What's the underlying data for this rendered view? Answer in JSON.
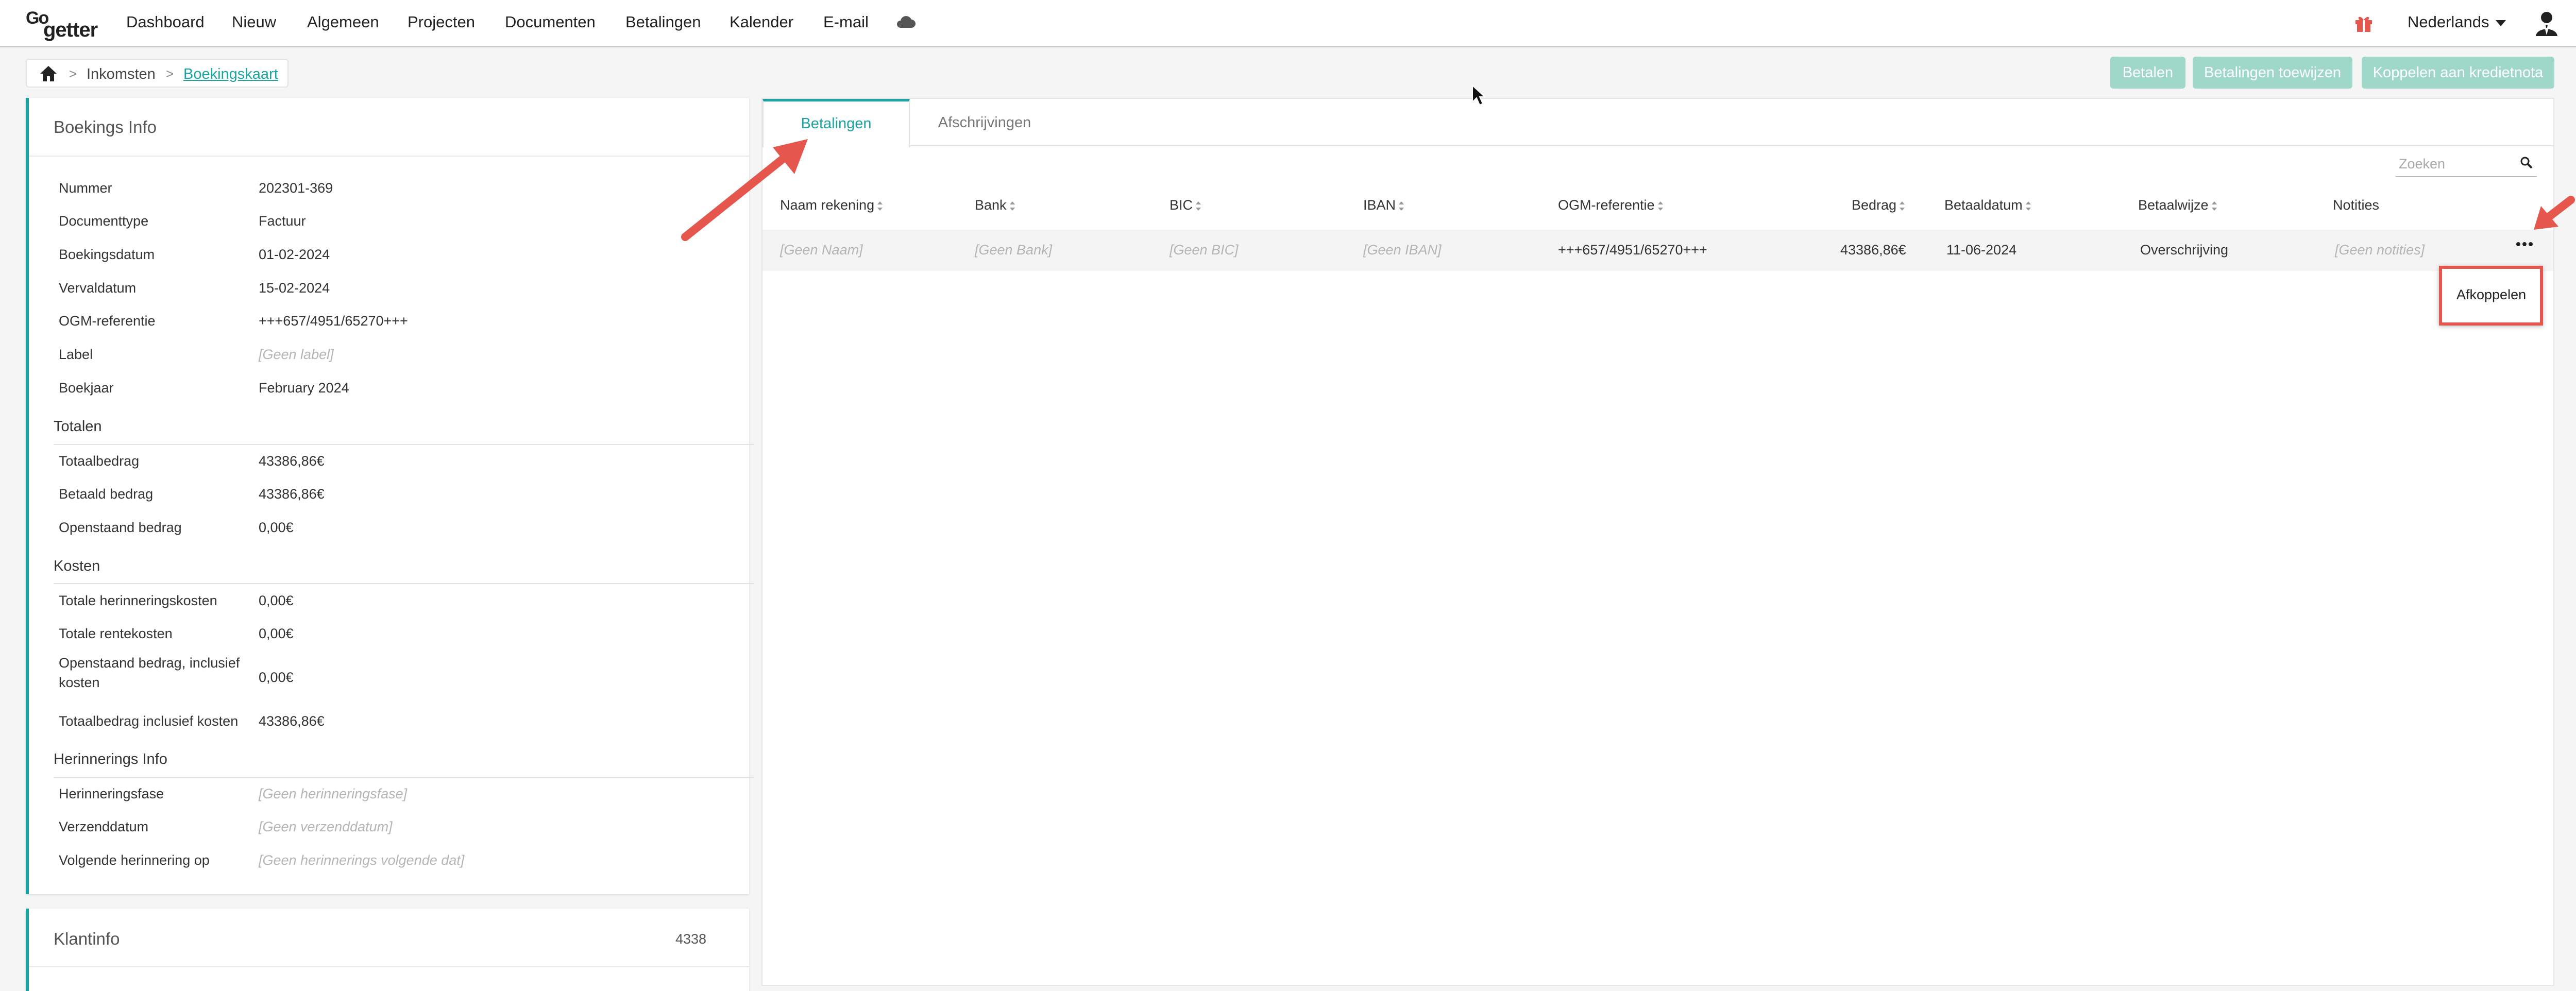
{
  "nav": {
    "logo_go": "Go",
    "logo_getter": "getter",
    "items": [
      "Dashboard",
      "Nieuw",
      "Algemeen",
      "Projecten",
      "Documenten",
      "Betalingen",
      "Kalender",
      "E-mail"
    ],
    "language": "Nederlands",
    "icons": [
      "cloud-icon",
      "gift-icon",
      "user-icon"
    ],
    "gift_color": "#e5574d"
  },
  "breadcrumb": {
    "items": [
      "Inkomsten",
      "Boekingskaart"
    ]
  },
  "actions": {
    "pay": "Betalen",
    "assign": "Betalingen toewijzen",
    "link_credit": "Koppelen aan kredietnota"
  },
  "booking": {
    "title": "Boekings Info",
    "fields": [
      {
        "label": "Nummer",
        "value": "202301-369"
      },
      {
        "label": "Documenttype",
        "value": "Factuur"
      },
      {
        "label": "Boekingsdatum",
        "value": "01-02-2024"
      },
      {
        "label": "Vervaldatum",
        "value": "15-02-2024"
      },
      {
        "label": "OGM-referentie",
        "value": "+++657/4951/65270+++"
      },
      {
        "label": "Label",
        "value": "[Geen label]"
      },
      {
        "label": "Boekjaar",
        "value": "February 2024"
      }
    ],
    "totals_title": "Totalen",
    "totals": [
      {
        "label": "Totaalbedrag",
        "value": "43386,86€"
      },
      {
        "label": "Betaald bedrag",
        "value": "43386,86€"
      },
      {
        "label": "Openstaand bedrag",
        "value": "0,00€"
      }
    ],
    "costs_title": "Kosten",
    "costs": [
      {
        "label": "Totale herinneringskosten",
        "value": "0,00€"
      },
      {
        "label": "Totale rentekosten",
        "value": "0,00€"
      },
      {
        "label": "Openstaand bedrag, inclusief kosten",
        "value": "0,00€"
      },
      {
        "label": "Totaalbedrag inclusief kosten",
        "value": "43386,86€"
      }
    ],
    "reminder_title": "Herinnerings Info",
    "reminders": [
      {
        "label": "Herinneringsfase",
        "value": "[Geen herinneringsfase]"
      },
      {
        "label": "Verzenddatum",
        "value": "[Geen verzenddatum]"
      },
      {
        "label": "Volgende herinnering op",
        "value": "[Geen herinnerings volgende dat]"
      }
    ]
  },
  "client": {
    "title": "Klantinfo",
    "number": "4338"
  },
  "payments": {
    "tabs": [
      "Betalingen",
      "Afschrijvingen"
    ],
    "search_placeholder": "Zoeken",
    "columns": [
      "Naam rekening",
      "Bank",
      "BIC",
      "IBAN",
      "OGM-referentie",
      "Bedrag",
      "Betaaldatum",
      "Betaalwijze",
      "Notities"
    ],
    "rows": [
      {
        "naam": "[Geen Naam]",
        "bank": "[Geen Bank]",
        "bic": "[Geen BIC]",
        "iban": "[Geen IBAN]",
        "ogm": "+++657/4951/65270+++",
        "bedrag": "43386,86€",
        "datum": "11-06-2024",
        "wijze": "Overschrijving",
        "notities": "[Geen notities]"
      }
    ],
    "row_menu": [
      "Afkoppelen"
    ]
  },
  "colors": {
    "accent": "#1aa3a3",
    "button": "#9fd7c8",
    "annotation": "#e5574d"
  }
}
